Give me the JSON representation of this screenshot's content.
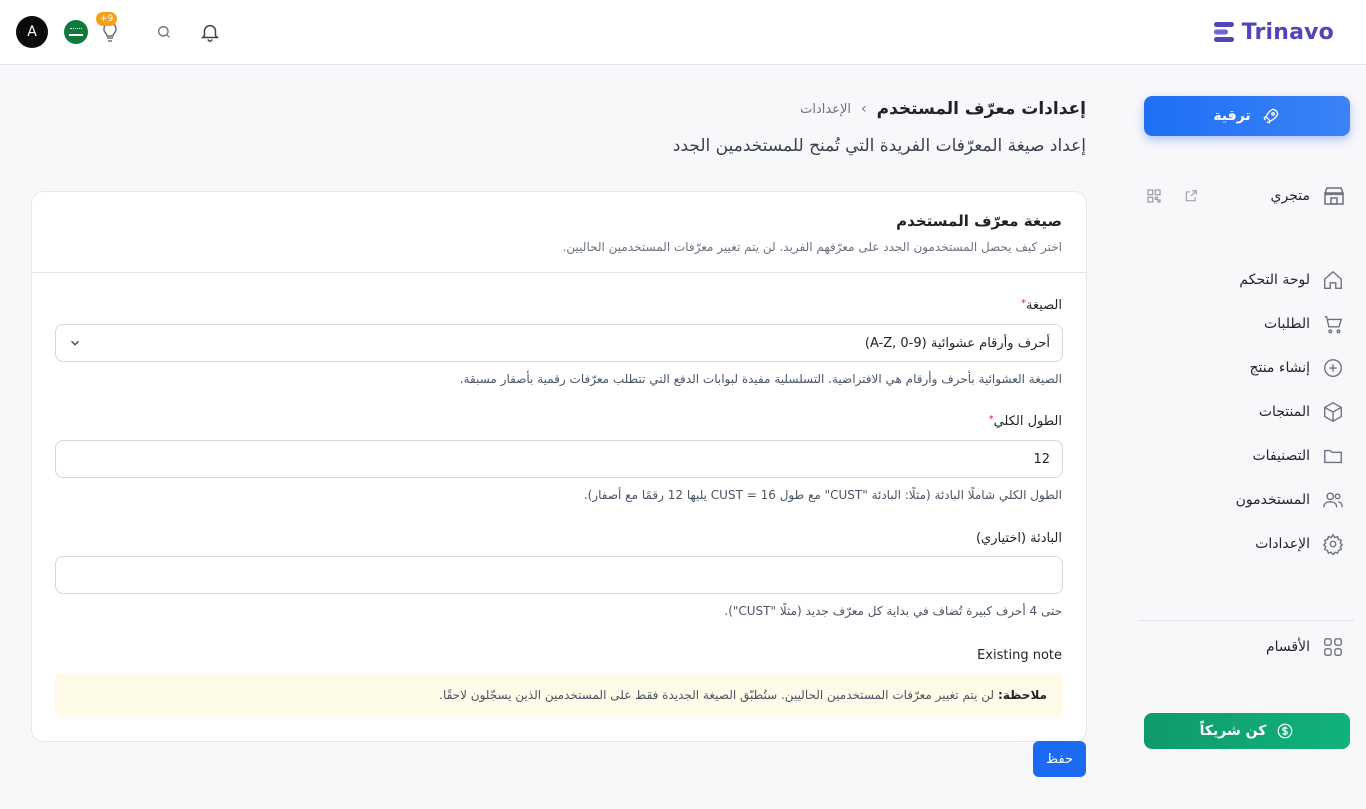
{
  "brand": {
    "name": "Trinavo"
  },
  "topbar": {
    "avatar_letter": "A",
    "notification_badge": "+9"
  },
  "sidebar": {
    "upgrade_label": "ترقية",
    "store_label": "متجري",
    "items": [
      {
        "label": "لوحة التحكم",
        "icon": "home-icon"
      },
      {
        "label": "الطلبات",
        "icon": "cart-icon"
      },
      {
        "label": "إنشاء منتج",
        "icon": "plus-circle-icon"
      },
      {
        "label": "المنتجات",
        "icon": "box-icon"
      },
      {
        "label": "التصنيفات",
        "icon": "folder-icon"
      },
      {
        "label": "المستخدمون",
        "icon": "users-icon"
      },
      {
        "label": "الإعدادات",
        "icon": "gear-icon"
      }
    ],
    "sections_label": "الأقسام",
    "partner_label": "كن شريكاً"
  },
  "header": {
    "breadcrumb_root": "الإعدادات",
    "breadcrumb_sep": "›",
    "title": "إعدادات معرّف المستخدم",
    "subtitle": "إعداد صيغة المعرّفات الفريدة التي تُمنح للمستخدمين الجدد"
  },
  "card": {
    "title": "صيغة معرّف المستخدم",
    "description": "اختر كيف يحصل المستخدمون الجدد على معرّفهم الفريد. لن يتم تغيير معرّفات المستخدمين الحاليين.",
    "format": {
      "label": "الصيغة",
      "value": "أحرف وأرقام عشوائية (A-Z, 0-9)",
      "hint": "الصيغة العشوائية بأحرف وأرقام هي الافتراضية. التسلسلية مفيدة لبوابات الدفع التي تتطلب معرّفات رقمية بأصفار مسبقة."
    },
    "length": {
      "label": "الطول الكلي",
      "value": "12",
      "hint": "الطول الكلي شاملًا البادئة (مثلًا: البادئة \"CUST\" مع طول 16 = CUST يليها 12 رقمًا مع أصفار)."
    },
    "prefix": {
      "label": "البادئة (اختياري)",
      "value": "",
      "hint": "حتى 4 أحرف كبيرة تُضاف في بداية كل معرّف جديد (مثلًا \"CUST\")."
    },
    "existing_note_label": "Existing note",
    "note_bold": "ملاحظة:",
    "note_text": "لن يتم تغيير معرّفات المستخدمين الحاليين. ستُطبّق الصيغة الجديدة فقط على المستخدمين الذين يسجّلون لاحقًا."
  },
  "save_label": "حفظ",
  "colors": {
    "primary": "#1d6af2",
    "brand": "#5046b8",
    "partner": "#10b37a",
    "note_bg": "#fefce8"
  }
}
